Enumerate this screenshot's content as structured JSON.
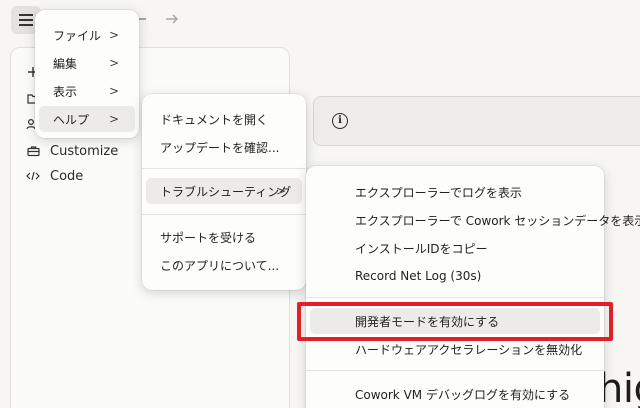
{
  "sidebar": {
    "items": [
      {
        "label": "",
        "icon": "plus-icon"
      },
      {
        "label": "",
        "icon": "folder-icon"
      },
      {
        "label": "",
        "icon": "users-icon"
      },
      {
        "label": "Customize",
        "icon": "briefcase-icon"
      },
      {
        "label": "Code",
        "icon": "code-icon"
      }
    ]
  },
  "main": {
    "big_text": "hig",
    "info_icon": "i"
  },
  "menu_main": {
    "items": [
      {
        "label": "ファイル",
        "arrow": ">"
      },
      {
        "label": "編集",
        "arrow": ">"
      },
      {
        "label": "表示",
        "arrow": ">"
      },
      {
        "label": "ヘルプ",
        "arrow": ">"
      }
    ]
  },
  "menu_help": {
    "items": [
      {
        "label": "ドキュメントを開く"
      },
      {
        "label": "アップデートを確認..."
      },
      {
        "label": "トラブルシューティング",
        "arrow": ">"
      },
      {
        "label": "サポートを受ける"
      },
      {
        "label": "このアプリについて..."
      }
    ]
  },
  "menu_troubleshoot": {
    "items": [
      {
        "label": "エクスプローラーでログを表示"
      },
      {
        "label": "エクスプローラーで Cowork セッションデータを表示"
      },
      {
        "label": "インストールIDをコピー"
      },
      {
        "label": "Record Net Log (30s)"
      },
      {
        "label": "開発者モードを有効にする"
      },
      {
        "label": "ハードウェアアクセラレーションを無効化"
      },
      {
        "label": "Cowork VM デバッグログを有効にする"
      }
    ]
  },
  "colors": {
    "highlight_annotation": "#e01f26",
    "menu_hover": "#ecebe8"
  }
}
